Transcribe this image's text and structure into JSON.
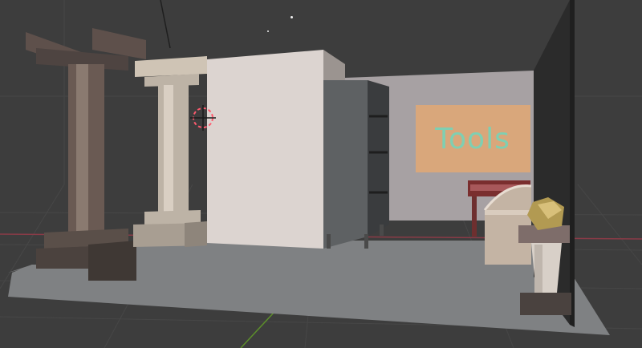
{
  "scene": {
    "sign_text": "Tools",
    "colors": {
      "viewport_bg": "#3d3d3d",
      "grid_line": "#474747",
      "x_axis": "#8a3b47",
      "y_axis": "#5c8f2a",
      "floor": "#7f8183",
      "back_wall": "#a7a1a3",
      "sign_board": "#d9a77b",
      "sign_text": "#7fcfb2",
      "column_stone": "#bdb3a6",
      "wall_panel": "#dcd4d0",
      "shelf_unit": "#5e6163"
    },
    "objects": [
      "floor",
      "back-wall",
      "right-wall",
      "tools-sign",
      "column-left",
      "column-center",
      "wall-panel",
      "shelf-unit",
      "small-table",
      "chest",
      "pedestal",
      "rock",
      "3d-cursor",
      "light-point"
    ]
  }
}
